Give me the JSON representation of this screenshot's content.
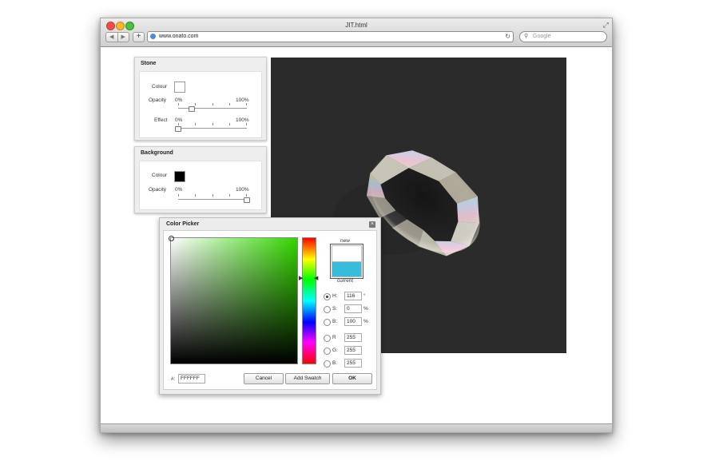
{
  "browser": {
    "title": "JIT.html",
    "url": "www.onato.com",
    "search_placeholder": "Google",
    "back_glyph": "◀",
    "forward_glyph": "▶",
    "new_tab_glyph": "+",
    "reload_glyph": "↻",
    "search_glyph": "⚲",
    "resize_glyph": "⤢"
  },
  "stone_panel": {
    "title": "Stone",
    "colour_label": "Colour",
    "colour_value": "#ffffff",
    "opacity_label": "Opacity",
    "opacity_min": "0%",
    "opacity_max": "100%",
    "opacity_value": 0.2,
    "effect_label": "Effect",
    "effect_min": "0%",
    "effect_max": "100%",
    "effect_value": 0.0
  },
  "background_panel": {
    "title": "Background",
    "colour_label": "Colour",
    "colour_value": "#000000",
    "opacity_label": "Opacity",
    "opacity_min": "0%",
    "opacity_max": "100%",
    "opacity_value": 1.0
  },
  "stage": {
    "background": "#2b2b2b",
    "content": "rendered gem"
  },
  "color_picker": {
    "title": "Color Picker",
    "close_glyph": "×",
    "new_label": "new",
    "current_label": "current",
    "new_color": "#ffffff",
    "current_color": "#37bcd9",
    "fields": {
      "h": {
        "label": "H:",
        "value": "116",
        "unit": "°",
        "selected": true
      },
      "s": {
        "label": "S:",
        "value": "0",
        "unit": "%",
        "selected": false
      },
      "b": {
        "label": "B:",
        "value": "100",
        "unit": "%",
        "selected": false
      },
      "r": {
        "label": "R",
        "value": "255",
        "selected": false
      },
      "g": {
        "label": "G:",
        "value": "255",
        "selected": false
      },
      "bl": {
        "label": "B:",
        "value": "255",
        "selected": false
      }
    },
    "hex_label": "#:",
    "hex_value": "FFFFFF",
    "buttons": {
      "cancel": "Cancel",
      "add_swatch": "Add Swatch",
      "ok": "OK"
    }
  }
}
